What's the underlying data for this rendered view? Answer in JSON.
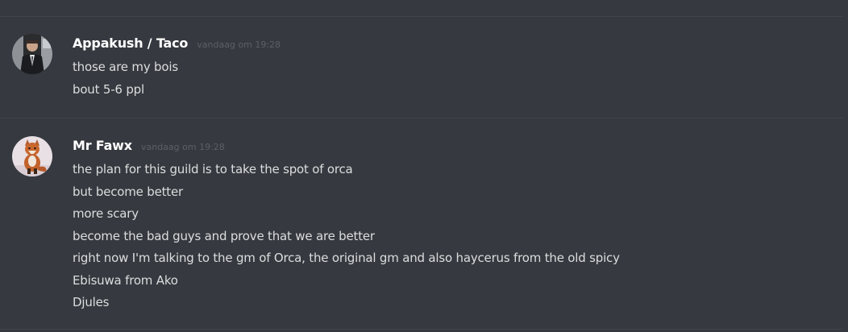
{
  "messages": [
    {
      "author": "Appakush / Taco",
      "timestamp": "vandaag om 19:28",
      "lines": [
        "those are my bois",
        "bout 5-6 ppl"
      ]
    },
    {
      "author": "Mr Fawx",
      "timestamp": "vandaag om 19:28",
      "lines": [
        "the plan for this guild is to take the spot of orca",
        "but become better",
        "more scary",
        "become the bad guys and prove that we are better",
        "right now I'm talking to the gm of Orca, the original gm and also haycerus from the old spicy",
        "Ebisuwa from Ako",
        "Djules"
      ]
    }
  ]
}
